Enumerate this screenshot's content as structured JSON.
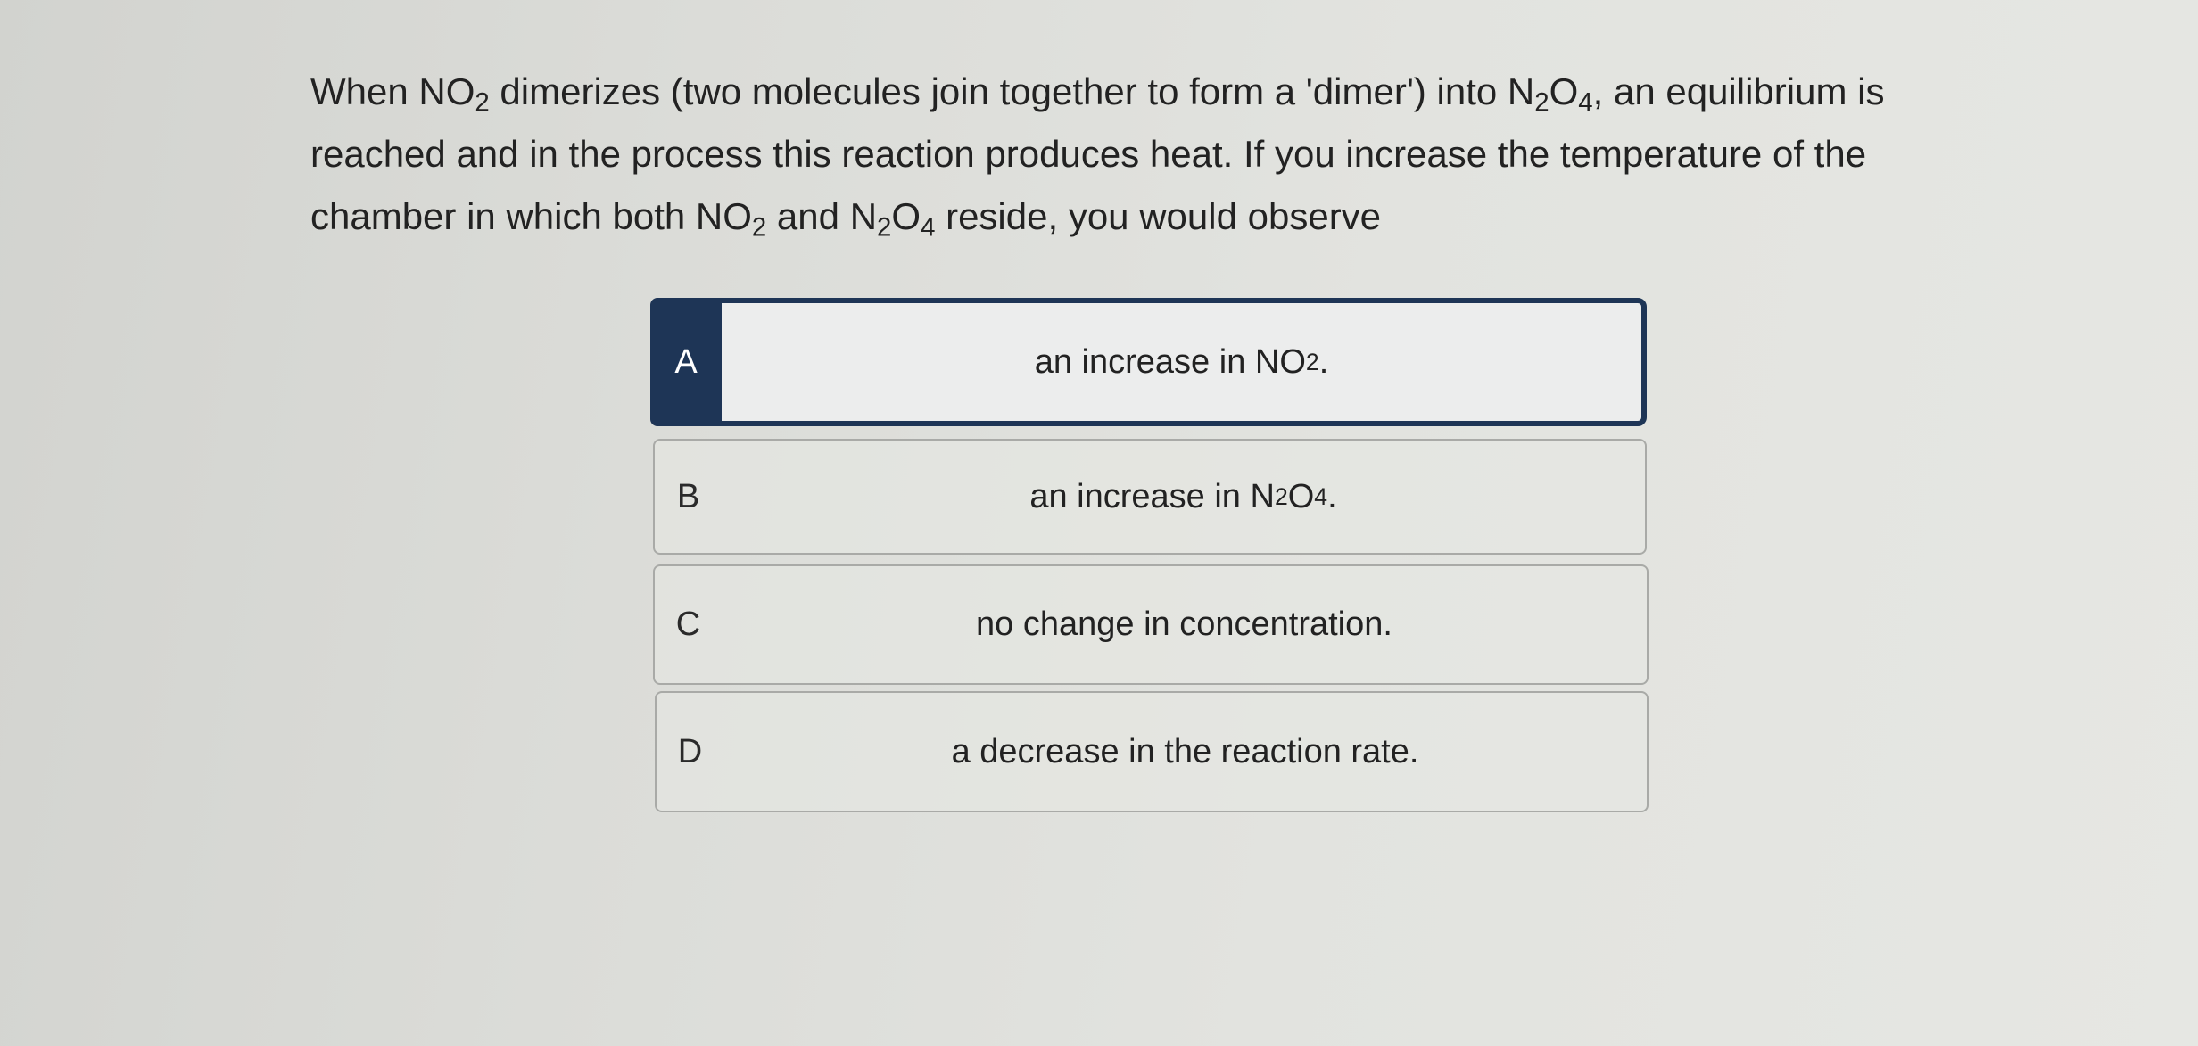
{
  "question": {
    "intro": "When ",
    "no2_base": "NO",
    "no2_sub": "2",
    "mid1": " dimerizes (two molecules join together to form a 'dimer') into ",
    "n2o4_n": "N",
    "n2o4_sub1": "2",
    "n2o4_o": "O",
    "n2o4_sub2": "4",
    "mid2": ", an equilibrium is reached and in the process this reaction produces heat. If you increase the temperature of the chamber in which both ",
    "no2b_base": "NO",
    "no2b_sub": "2",
    "and": " and ",
    "n2o4b_n": "N",
    "n2o4b_sub1": "2",
    "n2o4b_o": "O",
    "n2o4b_sub2": "4",
    "end": " reside, you would observe"
  },
  "options": [
    {
      "letter": "A",
      "pre": "an increase in NO",
      "sub": "2",
      "post": ".",
      "selected": true
    },
    {
      "letter": "B",
      "pre": "an increase in N",
      "sub1": "2",
      "mid": "O",
      "sub2": "4",
      "post": ".",
      "selected": false
    },
    {
      "letter": "C",
      "text": "no change in concentration.",
      "selected": false
    },
    {
      "letter": "D",
      "text": "a decrease in the reaction rate.",
      "selected": false
    }
  ],
  "colors": {
    "selected_accent": "#1e3556",
    "option_border": "#a9aaa7",
    "background": "#dcddd9",
    "text": "#222222"
  }
}
